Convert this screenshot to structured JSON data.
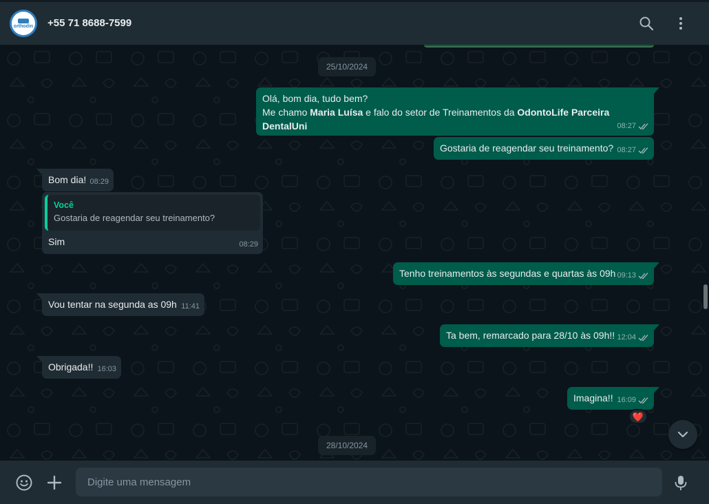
{
  "header": {
    "contact_name": "+55 71 8688-7599",
    "avatar_text": "orthodin",
    "search_icon": "search-icon",
    "menu_icon": "kebab-menu-icon"
  },
  "colors": {
    "header_bg": "#202c33",
    "chat_bg": "#0b141a",
    "outgoing_bubble": "#005c4b",
    "incoming_bubble": "#202c33",
    "quote_accent": "#06cf9c"
  },
  "chat": {
    "date_1": "25/10/2024",
    "date_2": "28/10/2024",
    "m1": {
      "line1": "Olá, bom dia, tudo bem?",
      "line2_pre": "Me chamo ",
      "line2_bold": "Maria Luísa",
      "line2_mid": " e falo do setor de Treinamentos da ",
      "line2_bold2": "OdontoLife Parceira DentalUni",
      "time": "08:27"
    },
    "m2": {
      "text": "Gostaria de reagendar seu treinamento?",
      "time": "08:27"
    },
    "m3": {
      "text": "Bom dia!",
      "time": "08:29"
    },
    "m4": {
      "quote_author": "Você",
      "quote_text": "Gostaria de reagendar seu treinamento?",
      "text": "Sim",
      "time": "08:29"
    },
    "m5": {
      "text": "Tenho treinamentos às segundas e quartas às 09h",
      "time": "09:13"
    },
    "m6": {
      "text": "Vou tentar na segunda as 09h",
      "time": "11:41"
    },
    "m7": {
      "text": "Ta bem, remarcado para 28/10 às 09h!!",
      "time": "12:04"
    },
    "m8": {
      "text": "Obrigada!!",
      "time": "16:03"
    },
    "m9": {
      "text": "Imagina!!",
      "time": "16:09",
      "reaction": "❤️"
    }
  },
  "footer": {
    "placeholder": "Digite uma mensagem",
    "emoji_icon": "emoji-icon",
    "attach_icon": "plus-icon",
    "mic_icon": "microphone-icon"
  }
}
